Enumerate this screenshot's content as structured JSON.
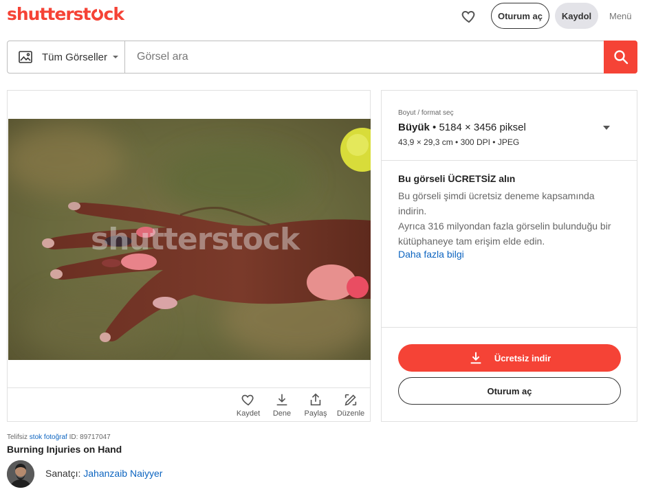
{
  "header": {
    "logo_pre": "shutterst",
    "logo_post": "ck",
    "login_label": "Oturum aç",
    "signup_label": "Kaydol",
    "menu_label": "Menü"
  },
  "search": {
    "type_label": "Tüm Görseller",
    "placeholder": "Görsel ara"
  },
  "image": {
    "watermark": "shutterstock",
    "actions": [
      {
        "icon": "heart-icon",
        "label": "Kaydet"
      },
      {
        "icon": "download-icon",
        "label": "Dene"
      },
      {
        "icon": "share-icon",
        "label": "Paylaş"
      },
      {
        "icon": "edit-icon",
        "label": "Düzenle"
      }
    ]
  },
  "license": {
    "caption": "Boyut / format seç",
    "size_name": "Büyük",
    "size_pixels": "5184 × 3456 piksel",
    "size_details": "43,9 × 29,3 cm • 300 DPI • JPEG",
    "free_title": "Bu görseli ÜCRETSİZ alın",
    "free_text_1": "Bu görseli şimdi ücretsiz deneme kapsamında indirin.",
    "free_text_2": "Ayrıca 316 milyondan fazla görselin bulunduğu bir kütüphaneye tam erişim elde edin.",
    "more_info": "Daha fazla bilgi",
    "download_label": "Ücretsiz indir",
    "login_label": "Oturum aç"
  },
  "info": {
    "meta_prefix": "Telifsiz",
    "meta_link": "stok fotoğraf",
    "meta_id": "ID: 89717047",
    "title": "Burning Injuries on Hand",
    "artist_prefix": "Sanatçı:",
    "artist_name": "Jahanzaib Naiyyer"
  },
  "colors": {
    "accent": "#f54336",
    "link": "#0c64c0"
  }
}
